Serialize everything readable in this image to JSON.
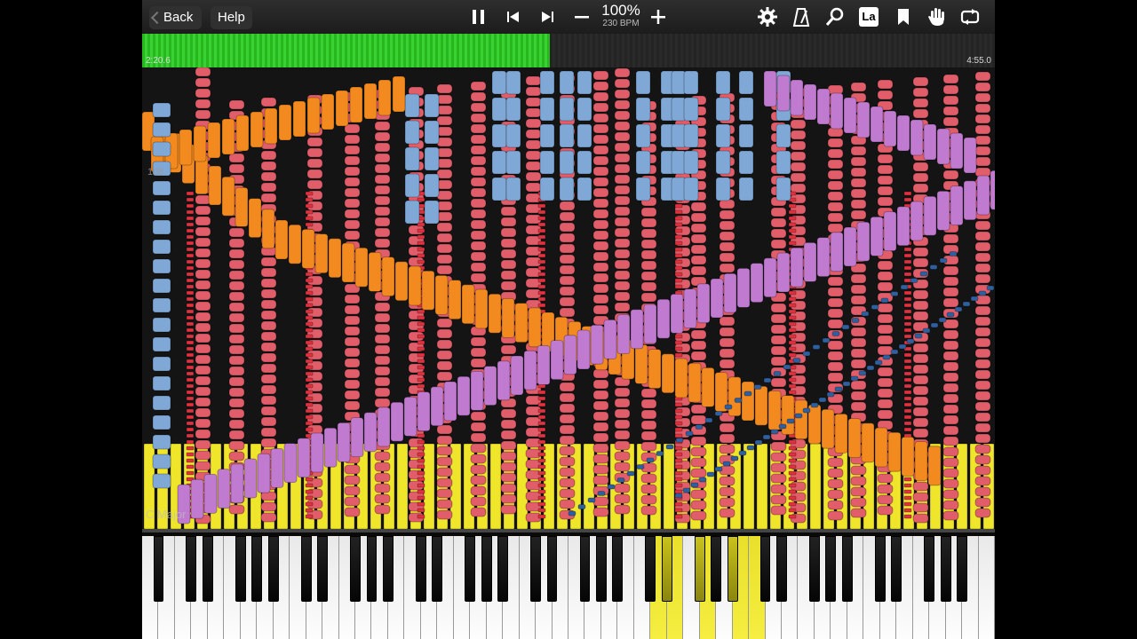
{
  "toolbar": {
    "back_label": "Back",
    "help_label": "Help",
    "zoom_text": "100%",
    "tempo_text": "230 BPM",
    "icons": [
      "pause-icon",
      "skip-back-icon",
      "skip-forward-icon",
      "minus-icon",
      "plus-icon",
      "gear-icon",
      "metronome-icon",
      "search-icon",
      "label-icon",
      "bookmark-icon",
      "hand-icon",
      "loop-icon"
    ],
    "label_icon_text": "La"
  },
  "progress": {
    "current_time": "2:20.6",
    "total_time": "4:55.0",
    "fraction": 0.478,
    "fill_color": "#2fc427"
  },
  "overlay": {
    "key_signature": "C Major",
    "measure_number": "108"
  },
  "colors": {
    "red": "#e25d6a",
    "orange": "#f28a1f",
    "light_blue": "#7fa8d6",
    "dark_blue": "#2e5f9e",
    "purple": "#c07ad0",
    "yellow": "#efe52a",
    "background": "#141414"
  },
  "keyboard": {
    "white_key_count": 52,
    "active_color": "#efe52a"
  }
}
